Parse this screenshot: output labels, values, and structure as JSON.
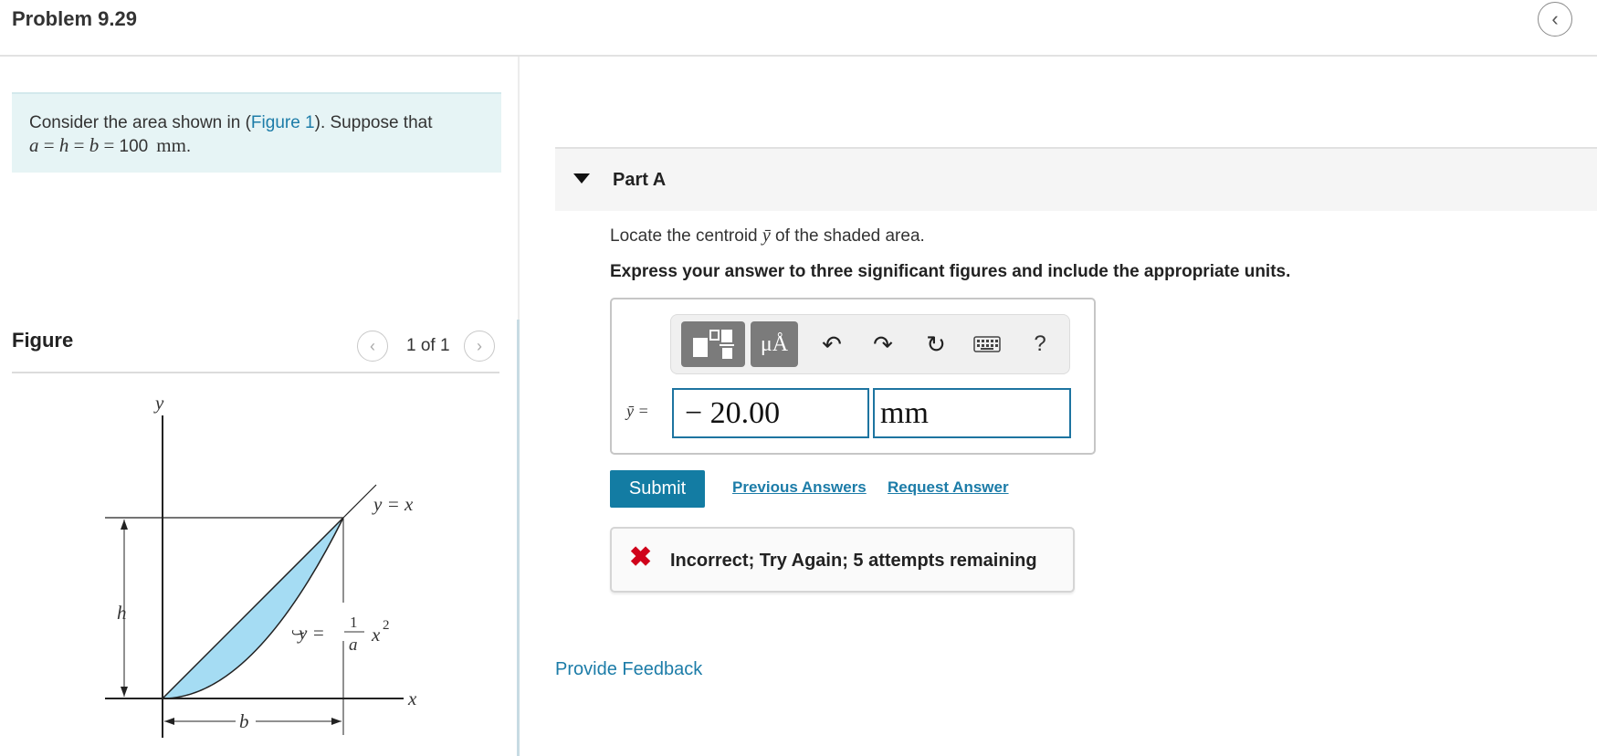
{
  "header": {
    "title": "Problem 9.29",
    "back_icon": "chevron-left-icon"
  },
  "intro": {
    "text_before_link": "Consider the area shown in (",
    "link_text": "Figure 1",
    "text_after_link": "). Suppose that",
    "formula": {
      "var_a": "a",
      "eq1": " = ",
      "var_h": "h",
      "eq2": " = ",
      "var_b": "b",
      "eq3": " = ",
      "value": "100",
      "unit": "mm",
      "period": "."
    }
  },
  "figure": {
    "heading": "Figure",
    "pager": "1 of 1",
    "labels": {
      "y_axis": "y",
      "x_axis": "x",
      "line_eq": "y = x",
      "curve_y": "y =",
      "curve_num": "1",
      "curve_den": "a",
      "curve_x": "x",
      "curve_exp": "2",
      "h": "h",
      "b": "b"
    },
    "fill_color": "#a5dcf3"
  },
  "partA": {
    "label": "Part A",
    "question_before": "Locate the centroid ",
    "question_symbol": "ȳ",
    "question_after": " of the shaded area.",
    "instruction": "Express your answer to three significant figures and include the appropriate units.",
    "toolbar": {
      "units_label": "μÅ",
      "undo_icon": "↶",
      "redo_icon": "↷",
      "reset_icon": "↻",
      "help_label": "?"
    },
    "answer": {
      "symbol_label": "ȳ =",
      "value": "− 20.00",
      "unit": "mm"
    },
    "submit_label": "Submit",
    "previous_answers": "Previous Answers",
    "request_answer": "Request Answer",
    "feedback": {
      "icon": "✖",
      "text": "Incorrect; Try Again; 5 attempts remaining"
    }
  },
  "provide_feedback": "Provide Feedback",
  "colors": {
    "accent": "#1c7ca8",
    "submit": "#137ca3",
    "error": "#d0021b",
    "intro_bg": "#e6f4f5"
  }
}
